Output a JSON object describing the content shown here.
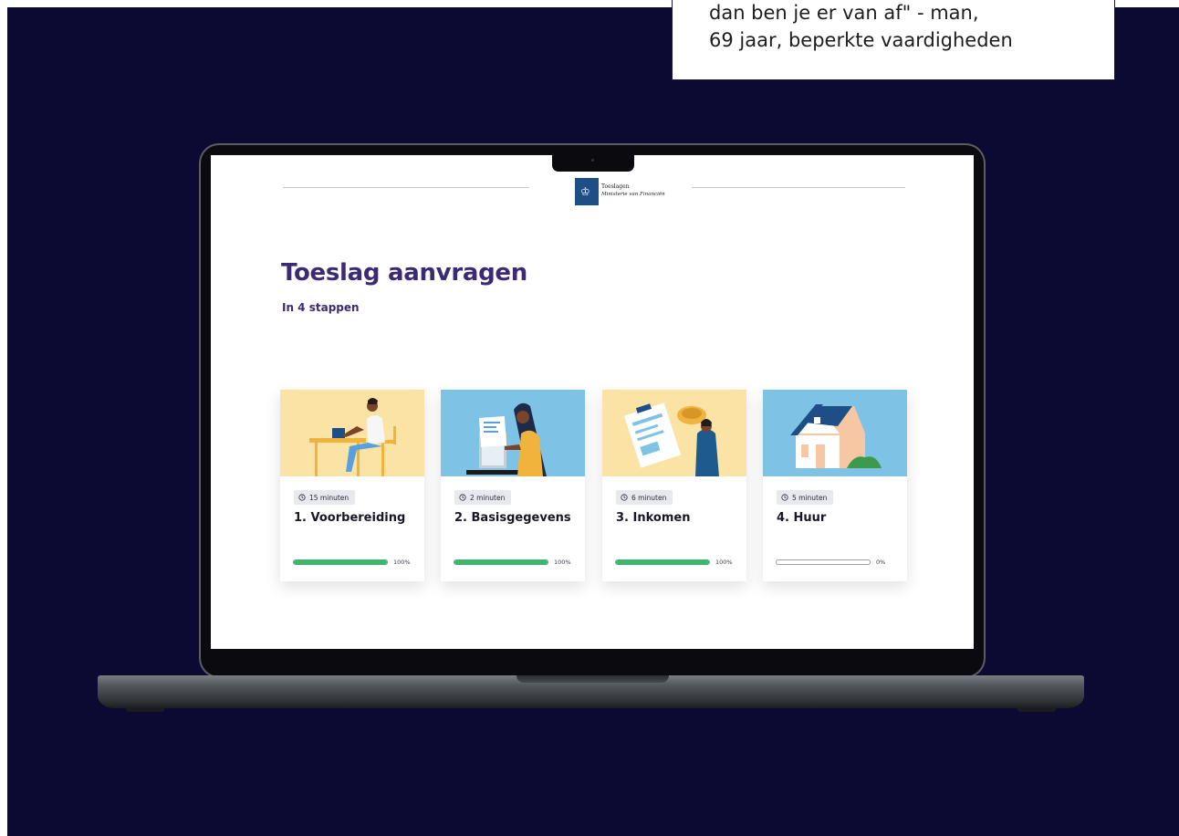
{
  "quote": {
    "line1": "dan ben je er van af\" - man,",
    "line2": "69 jaar, beperkte vaardigheden"
  },
  "header": {
    "logo_line1": "Toeslagen",
    "logo_line2": "Ministerie van Financiën"
  },
  "page": {
    "title": "Toeslag aanvragen",
    "subtitle": "In 4 stappen"
  },
  "steps": [
    {
      "duration": "15 minuten",
      "title": "1. Voorbereiding",
      "progress_label": "100%",
      "progress": 1.0
    },
    {
      "duration": "2 minuten",
      "title": "2. Basisgegevens",
      "progress_label": "100%",
      "progress": 1.0
    },
    {
      "duration": "6 minuten",
      "title": "3. Inkomen",
      "progress_label": "100%",
      "progress": 1.0
    },
    {
      "duration": "5 minuten",
      "title": "4. Huur",
      "progress_label": "0%",
      "progress": 0.0
    }
  ],
  "colors": {
    "background": "#0c0933",
    "title": "#3c2a74",
    "progress": "#3fb56e",
    "logo": "#1d4e86"
  },
  "icons": [
    "clock-icon",
    "royal-crest-icon"
  ]
}
